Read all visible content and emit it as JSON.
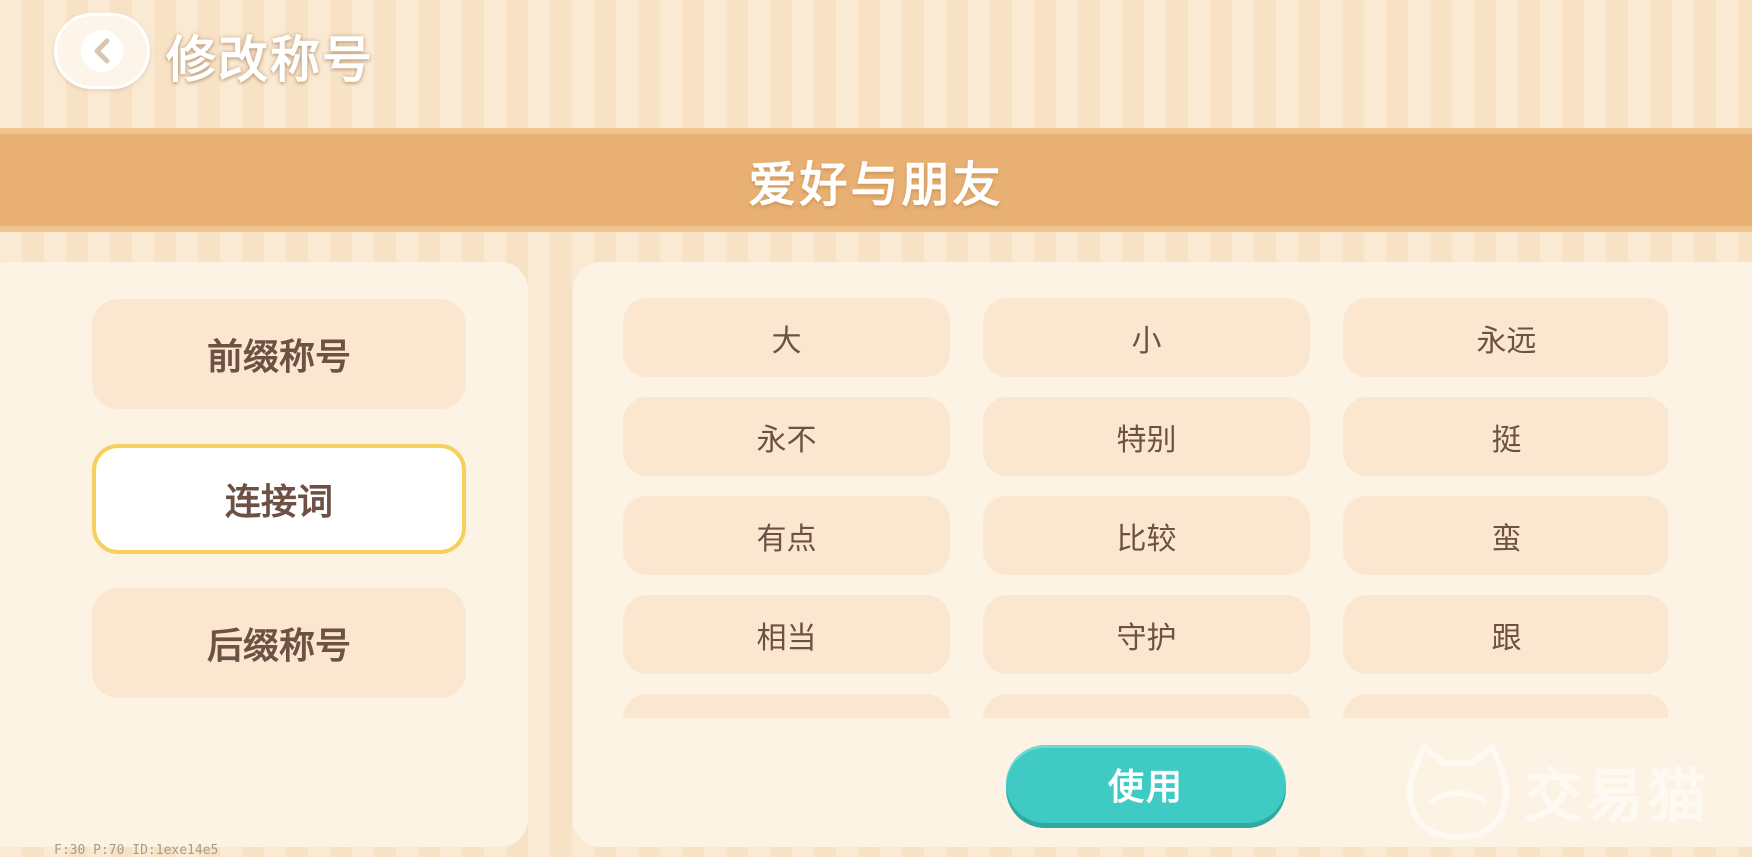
{
  "header": {
    "back_icon": "chevron-left-icon",
    "title": "修改称号"
  },
  "category": {
    "title": "爱好与朋友"
  },
  "tabs": [
    {
      "label": "前缀称号",
      "active": false
    },
    {
      "label": "连接词",
      "active": true
    },
    {
      "label": "后缀称号",
      "active": false
    }
  ],
  "words": [
    "大",
    "小",
    "永远",
    "永不",
    "特别",
    "挺",
    "有点",
    "比较",
    "蛮",
    "相当",
    "守护",
    "跟",
    "",
    "",
    ""
  ],
  "actions": {
    "use_label": "使用"
  },
  "watermark": {
    "text": "交易猫",
    "icon": "cat-logo-icon"
  },
  "debug": {
    "text": "F:30  P:70  ID:1exe14e5"
  },
  "colors": {
    "accent": "#e8b073",
    "primary_button": "#3fcbc3",
    "selected_border": "#f6cf5d",
    "text": "#6e5145"
  }
}
